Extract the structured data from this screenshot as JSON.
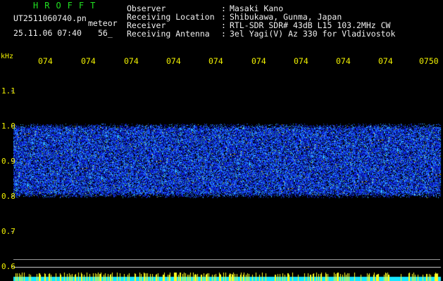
{
  "header": {
    "app_title": "HROFFT",
    "filename": "UT2511060740.pn",
    "mode": "meteor",
    "datetime": "25.11.06 07:40",
    "count": "56_",
    "fields": [
      {
        "label": "Observer",
        "colon": ":",
        "value": "Masaki Kano"
      },
      {
        "label": "Receiving Location",
        "colon": ":",
        "value": "Shibukawa, Gunma, Japan"
      },
      {
        "label": "Receiver",
        "colon": ":",
        "value": "RTL-SDR SDR# 43dB L15 103.2MHz CW"
      },
      {
        "label": "Receiving Antenna",
        "colon": ":",
        "value": "3el Yagi(V) Az 330 for Vladivostok"
      }
    ]
  },
  "spectrogram": {
    "y_unit": "kHz",
    "x_ticks": [
      "074",
      "074",
      "074",
      "074",
      "074",
      "074",
      "074",
      "074",
      "074",
      "0750"
    ],
    "y_ticks": [
      "1.1",
      "1.0",
      "0.9",
      "0.8",
      "0.7",
      "0.6"
    ],
    "band_khz": [
      0.8,
      1.0
    ],
    "y_range_khz": [
      0.58,
      1.15
    ],
    "colors": {
      "background": "#000000",
      "band_low": "#0a18d8",
      "band_high": "#38c8ff",
      "speck": "#e8f040",
      "bottom_strip": "#18e8ff",
      "bottom_noise": "#ffff20"
    }
  }
}
